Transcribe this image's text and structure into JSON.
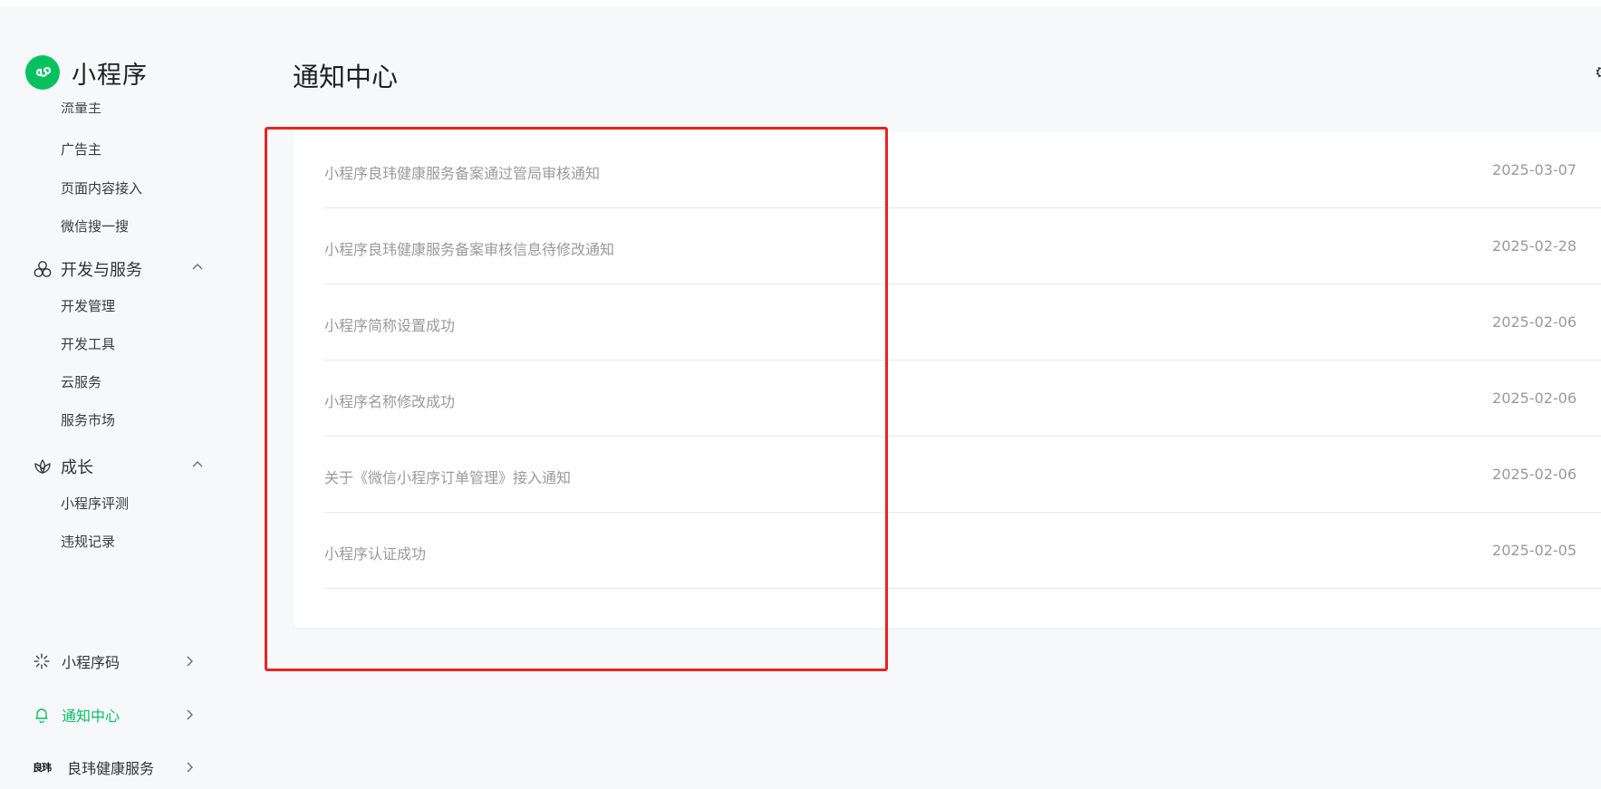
{
  "app": {
    "brand_name": "小程序",
    "accent_color": "#07c160",
    "highlight_color": "#e8231f"
  },
  "sidebar": {
    "partial_item": "流量主",
    "items_before": [
      {
        "label": "广告主"
      },
      {
        "label": "页面内容接入"
      },
      {
        "label": "微信搜一搜"
      }
    ],
    "groups": [
      {
        "label": "开发与服务",
        "icon": "circles-icon",
        "expanded": true,
        "items": [
          {
            "label": "开发管理"
          },
          {
            "label": "开发工具"
          },
          {
            "label": "云服务"
          },
          {
            "label": "服务市场"
          }
        ]
      },
      {
        "label": "成长",
        "icon": "lotus-icon",
        "expanded": true,
        "items": [
          {
            "label": "小程序评测"
          },
          {
            "label": "违规记录"
          }
        ]
      }
    ],
    "bottom": [
      {
        "label": "小程序码",
        "icon": "sparkle-icon",
        "active": false
      },
      {
        "label": "通知中心",
        "icon": "bell-icon",
        "active": true
      },
      {
        "label": "良玮健康服务",
        "icon": "account-logo",
        "active": false,
        "logo_text": "良玮"
      }
    ]
  },
  "main": {
    "title": "通知中心",
    "notifications": [
      {
        "title": "小程序良玮健康服务备案通过管局审核通知",
        "date": "2025-03-07"
      },
      {
        "title": "小程序良玮健康服务备案审核信息待修改通知",
        "date": "2025-02-28"
      },
      {
        "title": "小程序简称设置成功",
        "date": "2025-02-06"
      },
      {
        "title": "小程序名称修改成功",
        "date": "2025-02-06"
      },
      {
        "title": "关于《微信小程序订单管理》接入通知",
        "date": "2025-02-06"
      },
      {
        "title": "小程序认证成功",
        "date": "2025-02-05"
      }
    ]
  }
}
